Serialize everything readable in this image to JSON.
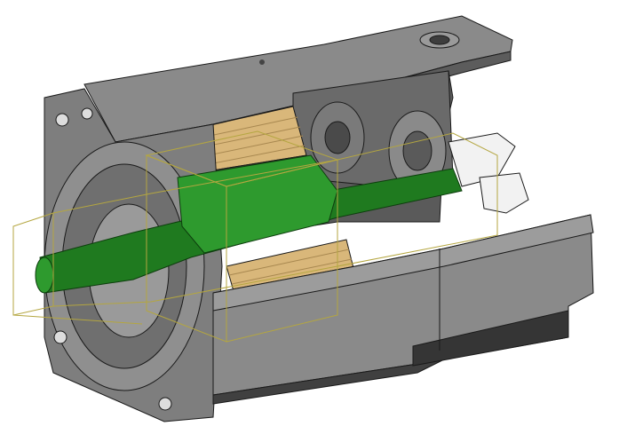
{
  "scene": {
    "subject": "motor-cutaway",
    "colors": {
      "background": "#ffffff",
      "housing_dark": "#4a4a4a",
      "housing_mid": "#6e6e6e",
      "housing_light": "#8c8c8c",
      "housing_highlight": "#b5b5b5",
      "shaft_green": "#1f7a1f",
      "shaft_green_light": "#2e9a2e",
      "winding_copper": "#d9b77a",
      "bounding_box_line": "#b4a640",
      "edge_black": "#1a1a1a"
    }
  }
}
